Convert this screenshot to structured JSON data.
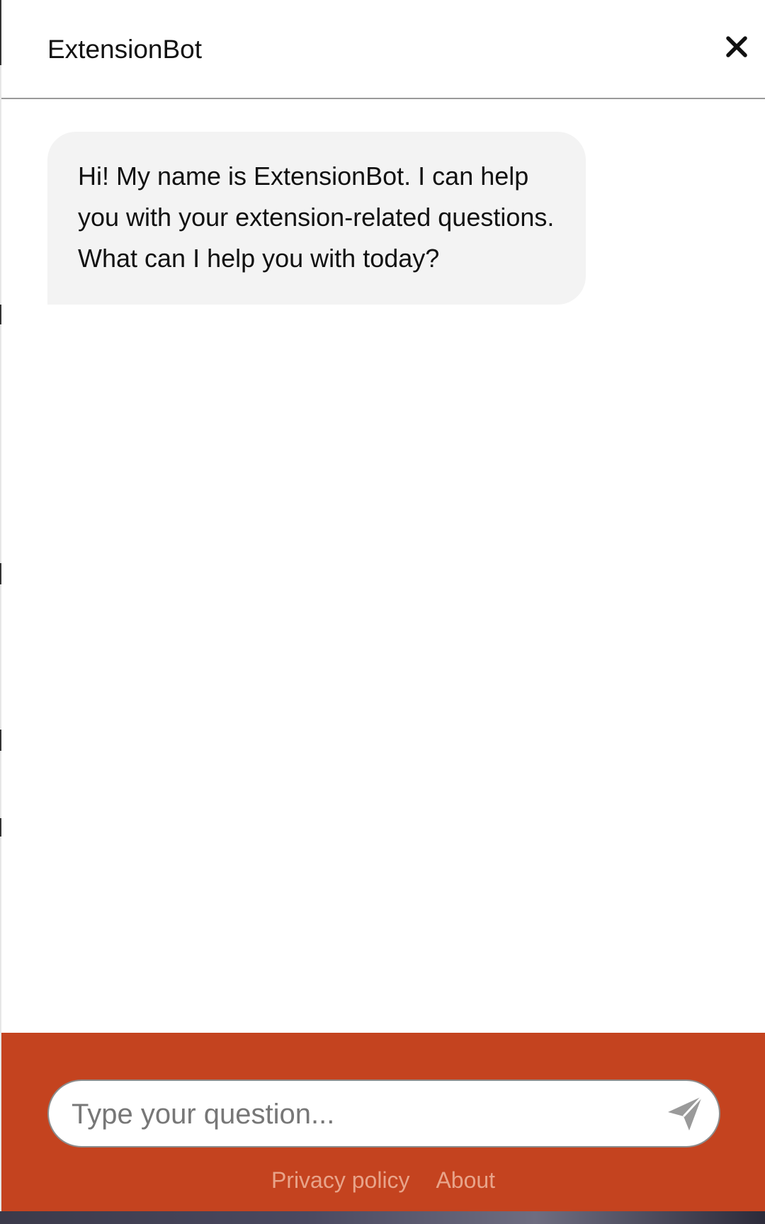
{
  "header": {
    "title": "ExtensionBot",
    "close_icon": "close-icon"
  },
  "messages": [
    {
      "sender": "bot",
      "text": "Hi! My name is ExtensionBot. I can help you with your extension-related questions. What can I help you with today?"
    }
  ],
  "composer": {
    "placeholder": "Type your question...",
    "value": "",
    "send_icon": "paper-plane-icon"
  },
  "footer": {
    "privacy_label": "Privacy policy",
    "about_label": "About"
  },
  "colors": {
    "footer_background": "#c4431f",
    "footer_link": "#e8a48a",
    "bubble_background": "#f3f3f3"
  }
}
